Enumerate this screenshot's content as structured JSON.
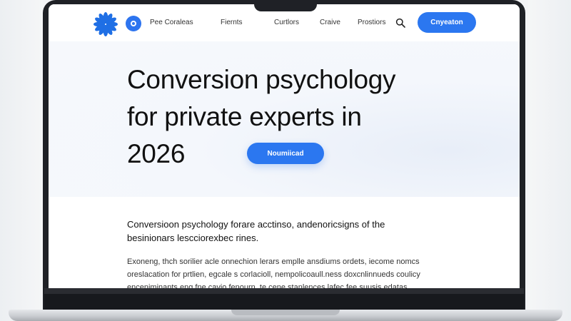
{
  "nav": {
    "links": [
      "Pee Coraleas",
      "Fiernts",
      "Curtlors",
      "Craive",
      "Prostiors"
    ],
    "cta_label": "Cnyeaton"
  },
  "hero": {
    "title_lines": [
      "Conversion psychology",
      "for private experts in",
      "2026"
    ],
    "button_label": "Noumiicad"
  },
  "content": {
    "subhead_lines": [
      "Conversioon psychology forare acctinso, andenoricsigns of the",
      "besinionars lescciorexbec rines."
    ],
    "paragraph_lines": [
      "Exoneng, thch sorilier acle onnechion lerars emplle ansdiums ordets, iecome nomcs",
      "oreslacation for prtlien, egcale s corlacioll, nempolicoaull.ness doxcnlinnueds coulicy",
      "enceniminants eng fne cavio fenourn, te cene stanlences lafec fee suusis edatas"
    ]
  },
  "colors": {
    "accent": "#2b77f0",
    "logo": "#1f6fe5",
    "hero_bg": "#f4f7fc",
    "bezel": "#1f2126"
  },
  "icons": [
    "logo-flower-icon",
    "avatar-icon",
    "search-icon"
  ]
}
